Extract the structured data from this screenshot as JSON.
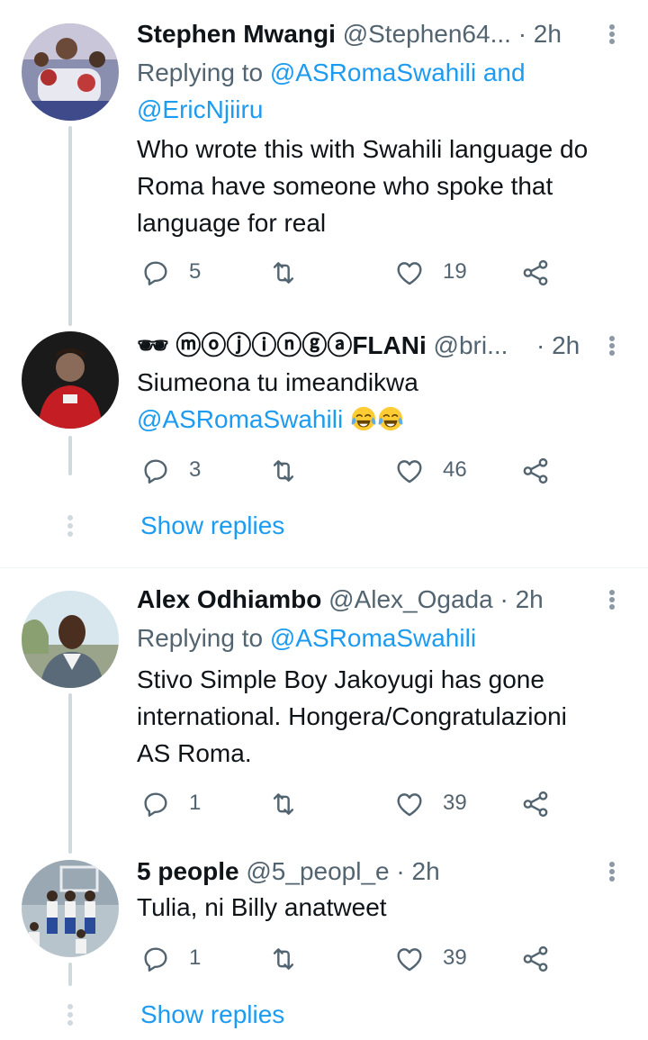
{
  "tweets": [
    {
      "name": "Stephen Mwangi",
      "handle": "@Stephen64...",
      "time": "· 2h",
      "replying_prefix": "Replying to ",
      "replying_to": "@ASRomaSwahili and",
      "replying_to_2": "@EricNjiiru",
      "text_lines": [
        "Who wrote this with Swahili language do",
        "Roma have someone who spoke that",
        "language for real"
      ],
      "replies": "5",
      "likes": "19"
    },
    {
      "name": "🕶 ⓜⓞⓙⓘⓝⓖⓐFLANi",
      "handle": "@bri...",
      "time": "· 2h",
      "text_line1": "Siumeona tu imeandikwa",
      "text_mention": "@ASRomaSwahili",
      "replies": "3",
      "likes": "46"
    },
    {
      "name": "Alex Odhiambo",
      "handle": "@Alex_Ogada",
      "time": "· 2h",
      "replying_prefix": "Replying to ",
      "replying_to": "@ASRomaSwahili",
      "text_lines": [
        "Stivo Simple Boy Jakoyugi has gone",
        "international. Hongera/Congratulazioni",
        "AS Roma."
      ],
      "replies": "1",
      "likes": "39"
    },
    {
      "name": "5 people",
      "handle": "@5_peopl_e",
      "time": "· 2h",
      "text_lines": [
        "Tulia, ni Billy anatweet"
      ],
      "replies": "1",
      "likes": "39"
    }
  ],
  "show_replies": "Show replies",
  "icons": {
    "reply": "reply-icon",
    "retweet": "retweet-icon",
    "like": "heart-icon",
    "share": "share-icon",
    "more": "more-vertical-icon",
    "emoji": "face-with-tears-of-joy-icon"
  },
  "colors": {
    "link": "#1d9bf0",
    "secondary": "#536471",
    "thread_line": "#cfd9de"
  }
}
